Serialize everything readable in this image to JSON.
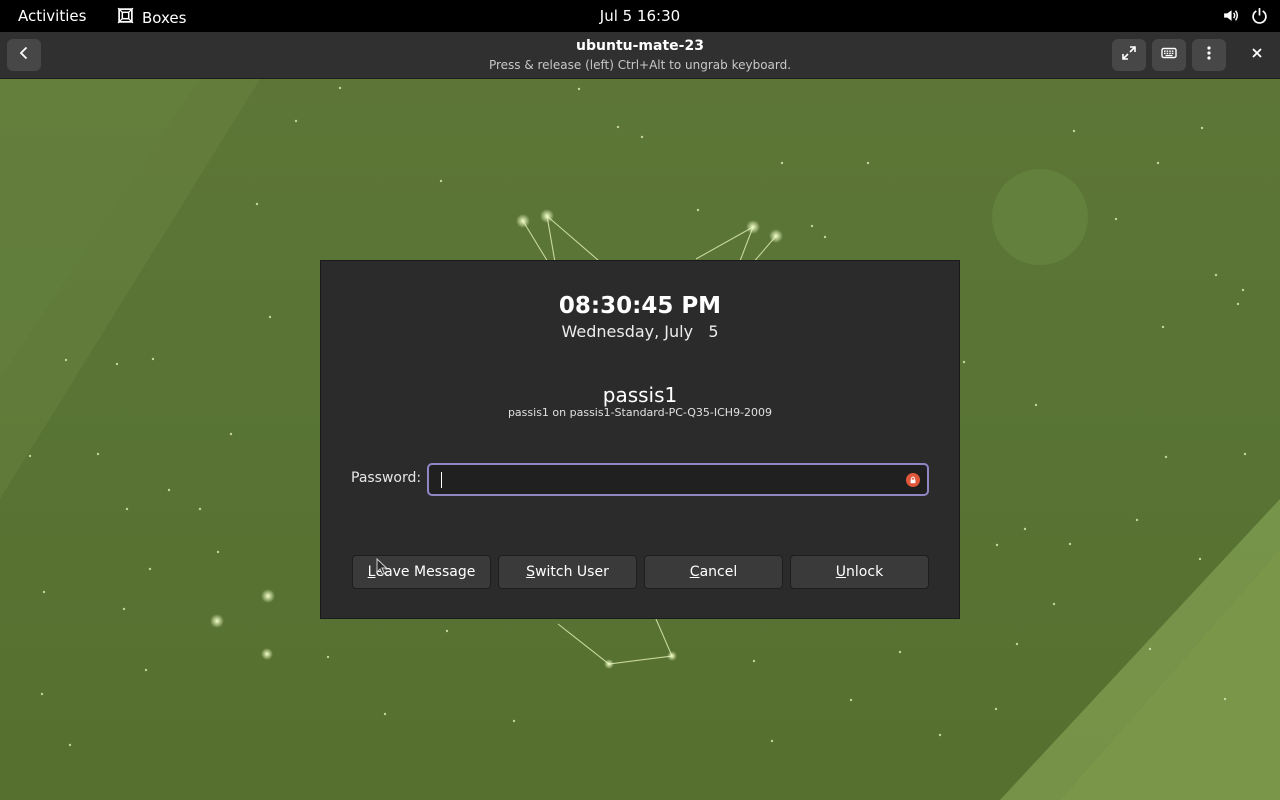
{
  "topbar": {
    "activities": "Activities",
    "app_name": "Boxes",
    "app_icon": "boxes-icon",
    "clock": "Jul 5  16:30",
    "status_icons": [
      "volume-icon",
      "power-icon"
    ]
  },
  "header": {
    "title": "ubuntu-mate-23",
    "subtitle": "Press & release (left) Ctrl+Alt to ungrab keyboard.",
    "buttons": [
      "back-icon",
      "fullscreen-icon",
      "keyboard-icon",
      "menu-icon",
      "close-icon"
    ]
  },
  "lock_dialog": {
    "time": "08:30:45 PM",
    "date": "Wednesday, July   5",
    "username": "passis1",
    "host": "passis1 on passis1-Standard-PC-Q35-ICH9-2009",
    "password_label": "Password:",
    "password_value": "",
    "buttons": {
      "leave_message": {
        "mnemonic": "L",
        "rest": "eave Message"
      },
      "switch_user": {
        "mnemonic": "S",
        "rest": "witch User"
      },
      "cancel": {
        "mnemonic": "C",
        "rest": "ancel"
      },
      "unlock": {
        "mnemonic": "U",
        "rest": "nlock"
      }
    }
  },
  "colors": {
    "desktop_green": "#5a7434",
    "dialog_bg": "#2b2b2b",
    "focus_border": "#8f86c4",
    "lock_badge": "#e0563a"
  }
}
